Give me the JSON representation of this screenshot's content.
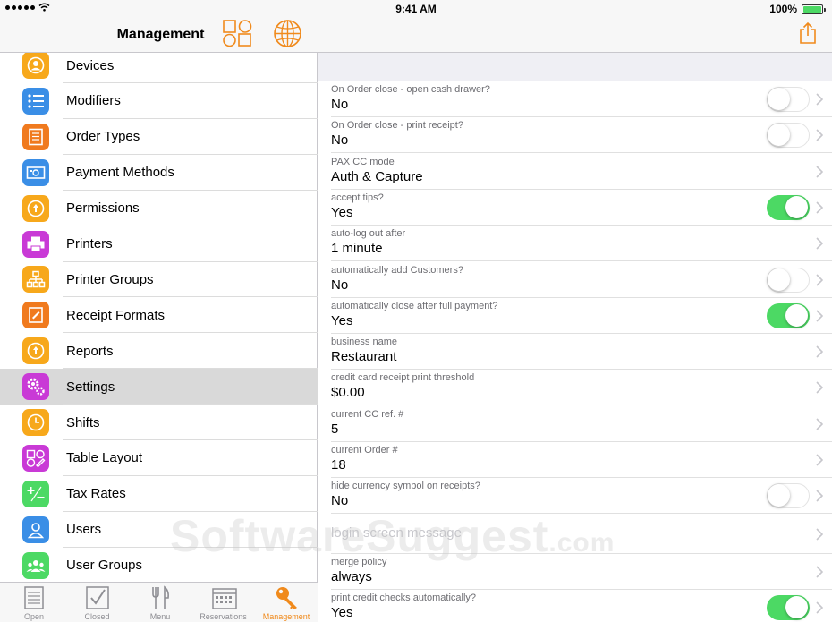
{
  "status": {
    "time": "9:41 AM",
    "battery": "100%"
  },
  "sidebar": {
    "title": "Management",
    "items": [
      {
        "label": "Devices",
        "color": "#f7a81b",
        "icon": "person-icon"
      },
      {
        "label": "Modifiers",
        "color": "#3a8ee6",
        "icon": "list-icon"
      },
      {
        "label": "Order Types",
        "color": "#f07a1e",
        "icon": "document-icon"
      },
      {
        "label": "Payment Methods",
        "color": "#3a8ee6",
        "icon": "cash-icon"
      },
      {
        "label": "Permissions",
        "color": "#f7a81b",
        "icon": "key-icon"
      },
      {
        "label": "Printers",
        "color": "#c93ad6",
        "icon": "printer-icon"
      },
      {
        "label": "Printer Groups",
        "color": "#f7a81b",
        "icon": "hierarchy-icon"
      },
      {
        "label": "Receipt Formats",
        "color": "#f07a1e",
        "icon": "receipt-icon"
      },
      {
        "label": "Reports",
        "color": "#f7a81b",
        "icon": "key-icon"
      },
      {
        "label": "Settings",
        "color": "#c93ad6",
        "icon": "gear-icon"
      },
      {
        "label": "Shifts",
        "color": "#f7a81b",
        "icon": "clock-icon"
      },
      {
        "label": "Table Layout",
        "color": "#c93ad6",
        "icon": "layout-icon"
      },
      {
        "label": "Tax Rates",
        "color": "#4cd964",
        "icon": "plus-minus-icon"
      },
      {
        "label": "Users",
        "color": "#3a8ee6",
        "icon": "user-icon"
      },
      {
        "label": "User Groups",
        "color": "#4cd964",
        "icon": "users-icon"
      }
    ],
    "selected_index": 9
  },
  "tabbar": {
    "tabs": [
      {
        "label": "Open",
        "icon": "notepad-icon"
      },
      {
        "label": "Closed",
        "icon": "checkbox-icon"
      },
      {
        "label": "Menu",
        "icon": "fork-knife-icon"
      },
      {
        "label": "Reservations",
        "icon": "calendar-icon"
      },
      {
        "label": "Management",
        "icon": "wrench-key-icon"
      }
    ],
    "active_index": 4,
    "active_color": "#f08a1c"
  },
  "settings": {
    "rows": [
      {
        "label": "On Order close - open cash drawer?",
        "value": "No",
        "toggle": "off"
      },
      {
        "label": "On Order close - print receipt?",
        "value": "No",
        "toggle": "off"
      },
      {
        "label": "PAX CC mode",
        "value": "Auth & Capture",
        "toggle": "none"
      },
      {
        "label": "accept tips?",
        "value": "Yes",
        "toggle": "on"
      },
      {
        "label": "auto-log out after",
        "value": "1 minute",
        "toggle": "none"
      },
      {
        "label": "automatically add Customers?",
        "value": "No",
        "toggle": "off"
      },
      {
        "label": "automatically close after full payment?",
        "value": "Yes",
        "toggle": "on"
      },
      {
        "label": "business name",
        "value": "Restaurant",
        "toggle": "none"
      },
      {
        "label": "credit card receipt print threshold",
        "value": "$0.00",
        "toggle": "none"
      },
      {
        "label": "current CC ref. #",
        "value": "5",
        "toggle": "none"
      },
      {
        "label": "current Order #",
        "value": "18",
        "toggle": "none"
      },
      {
        "label": "hide currency symbol on receipts?",
        "value": "No",
        "toggle": "off"
      },
      {
        "label": "login screen message",
        "value": "",
        "toggle": "none",
        "big": true
      },
      {
        "label": "merge policy",
        "value": "always",
        "toggle": "none"
      },
      {
        "label": "print credit checks automatically?",
        "value": "Yes",
        "toggle": "on"
      }
    ]
  },
  "watermark": {
    "main": "SoftwareSuggest",
    "suffix": ".com"
  },
  "colors": {
    "accent": "#f08a1c",
    "toggle_on": "#4cd964"
  }
}
